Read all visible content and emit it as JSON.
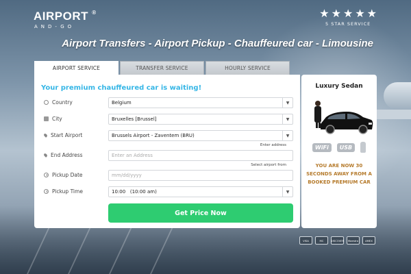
{
  "brand": {
    "logo_main": "AIRPORT",
    "logo_mark": "®",
    "logo_sub": "AND-GO"
  },
  "rating": {
    "stars": 5,
    "label": "5 STAR SERVICE"
  },
  "headline": "Airport Transfers - Airport Pickup - Chauffeured car - Limousine",
  "tabs": [
    {
      "label": "AIRPORT SERVICE",
      "active": true
    },
    {
      "label": "TRANSFER SERVICE",
      "active": false
    },
    {
      "label": "HOURLY SERVICE",
      "active": false
    }
  ],
  "form": {
    "tagline": "Your premium chauffeured car is waiting!",
    "country": {
      "label": "Country",
      "value": "Belgium",
      "icon": "globe-icon"
    },
    "city": {
      "label": "City",
      "value": "Bruxelles [Brussel]",
      "icon": "building-icon"
    },
    "start_airport": {
      "label": "Start Airport",
      "value": "Brussels Airport - Zaventem (BRU)",
      "icon": "pin-icon"
    },
    "hint_enter_address": "Enter address",
    "end_address": {
      "label": "End Address",
      "placeholder": "Enter an Address",
      "icon": "pin-icon"
    },
    "hint_select_airport": "Select airport from",
    "pickup_date": {
      "label": "Pickup Date",
      "placeholder": "mm/dd/yyyy",
      "icon": "clock-icon"
    },
    "pickup_time": {
      "label": "Pickup Time",
      "value": "10:00   (10:00 am)",
      "icon": "clock-icon"
    },
    "submit_label": "Get Price Now"
  },
  "side": {
    "title": "Luxury Sedan",
    "features": [
      "WiFi",
      "USB"
    ],
    "message": "YOU ARE NOW 30 SECONDS AWAY FROM A BOOKED PREMIUM CAR"
  },
  "payment_cards": [
    "VISA",
    "MC",
    "DISCOVER",
    "Maestro",
    "AMEX"
  ],
  "colors": {
    "accent": "#35b6e6",
    "cta": "#2ecc71",
    "promo_text": "#b57a2b"
  }
}
